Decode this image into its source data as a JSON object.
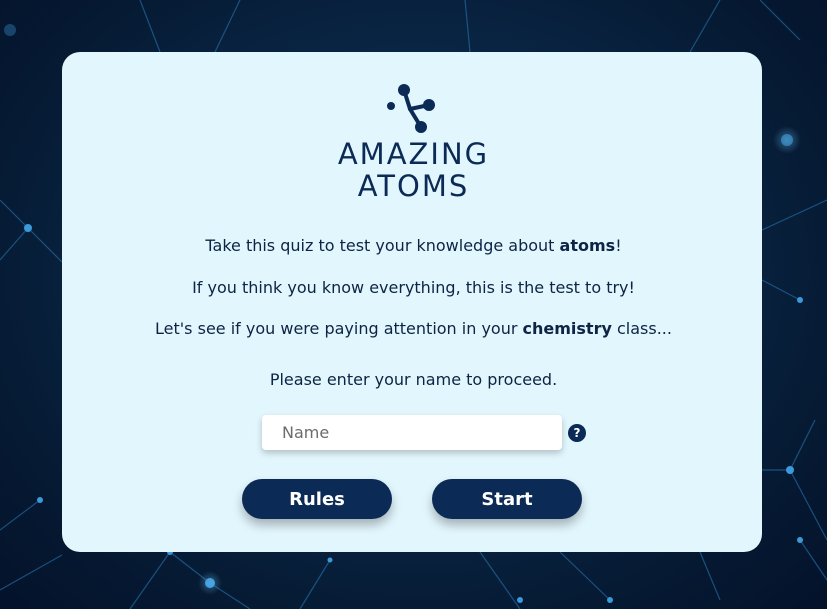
{
  "background": {
    "icon": "molecular-network-background",
    "colors": {
      "dark": "#061a33",
      "mid": "#0e3a66",
      "node": "#3b9ad9"
    }
  },
  "card": {
    "background": "#e2f6fd"
  },
  "logo": {
    "icon": "atom-molecule-icon",
    "line1": "AMAZING",
    "line2": "ATOMS",
    "color": "#0b2a55"
  },
  "intro": {
    "line1_pre": "Take this quiz to test your knowledge about ",
    "line1_bold": "atoms",
    "line1_post": "!",
    "line2": "If you think you know everything, this is the test to try!",
    "line3_pre": "Let's see if you were paying attention in your ",
    "line3_bold": "chemistry",
    "line3_post": " class...",
    "prompt": "Please enter your name to proceed."
  },
  "form": {
    "name_placeholder": "Name",
    "name_value": "",
    "help_icon": "question-circle-icon",
    "help_glyph": "?"
  },
  "buttons": {
    "rules_label": "Rules",
    "start_label": "Start",
    "color": "#0b2a55"
  }
}
